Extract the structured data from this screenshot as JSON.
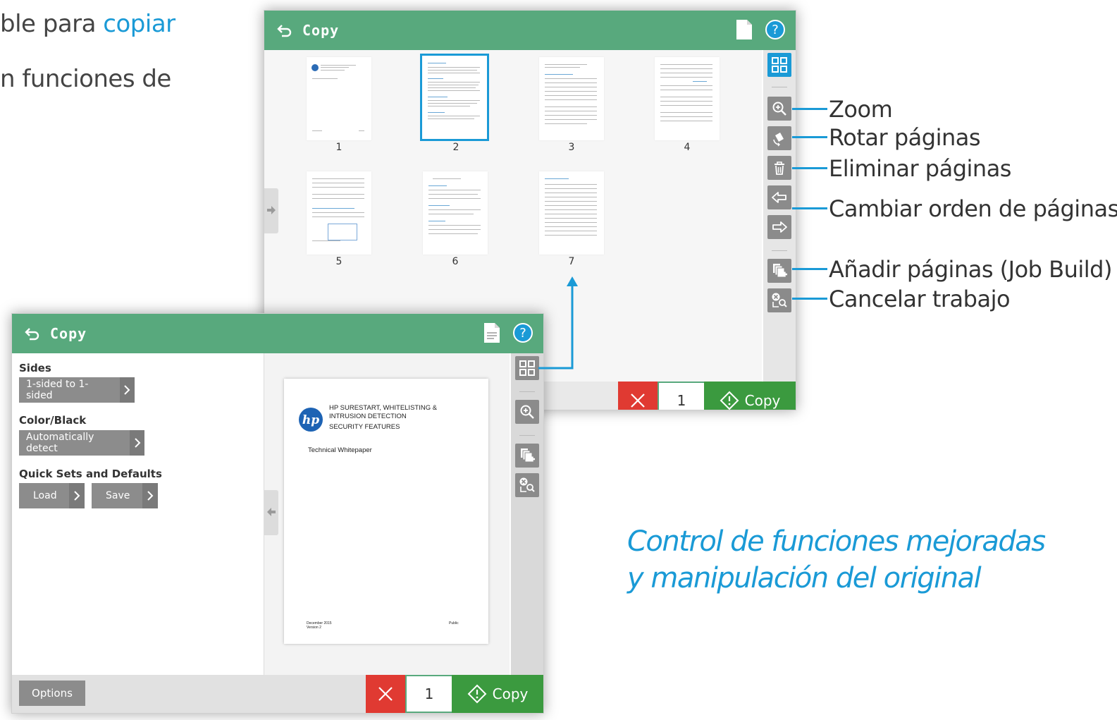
{
  "slide": {
    "line1_text": "ble para ",
    "line1_accent": "copiar",
    "line2_text": "n funciones de"
  },
  "back_panel": {
    "title": "Copy",
    "thumbnails": [
      "1",
      "2",
      "3",
      "4",
      "5",
      "6",
      "7"
    ],
    "selected_index": 2,
    "copies": "1",
    "copy_label": "Copy"
  },
  "front_panel": {
    "title": "Copy",
    "sides_label": "Sides",
    "sides_value": "1-sided to 1-sided",
    "color_label": "Color/Black",
    "color_value": "Automatically detect",
    "quicksets_label": "Quick Sets and Defaults",
    "load_label": "Load",
    "save_label": "Save",
    "options_label": "Options",
    "copies": "1",
    "copy_label": "Copy",
    "preview": {
      "heading_line1": "HP SURESTART, WHITELISTING &",
      "heading_line2": "INTRUSION DETECTION",
      "heading_line3": "SECURITY FEATURES",
      "subtitle": "Technical Whitepaper",
      "footer_left_1": "December 2015",
      "footer_left_2": "Version 2",
      "footer_right": "Public"
    }
  },
  "annotations": {
    "zoom": "Zoom",
    "rotate": "Rotar páginas",
    "delete": "Eliminar páginas",
    "reorder": "Cambiar orden de páginas",
    "add_pages": "Añadir páginas (Job Build)",
    "cancel_job": "Cancelar trabajo"
  },
  "caption": {
    "line1": "Control de funciones mejoradas",
    "line2": "y manipulación del original"
  },
  "colors": {
    "header_green": "#58a97d",
    "copy_green": "#3b9a3f",
    "accent_blue": "#1a9ad6",
    "cancel_red": "#e03a32"
  }
}
